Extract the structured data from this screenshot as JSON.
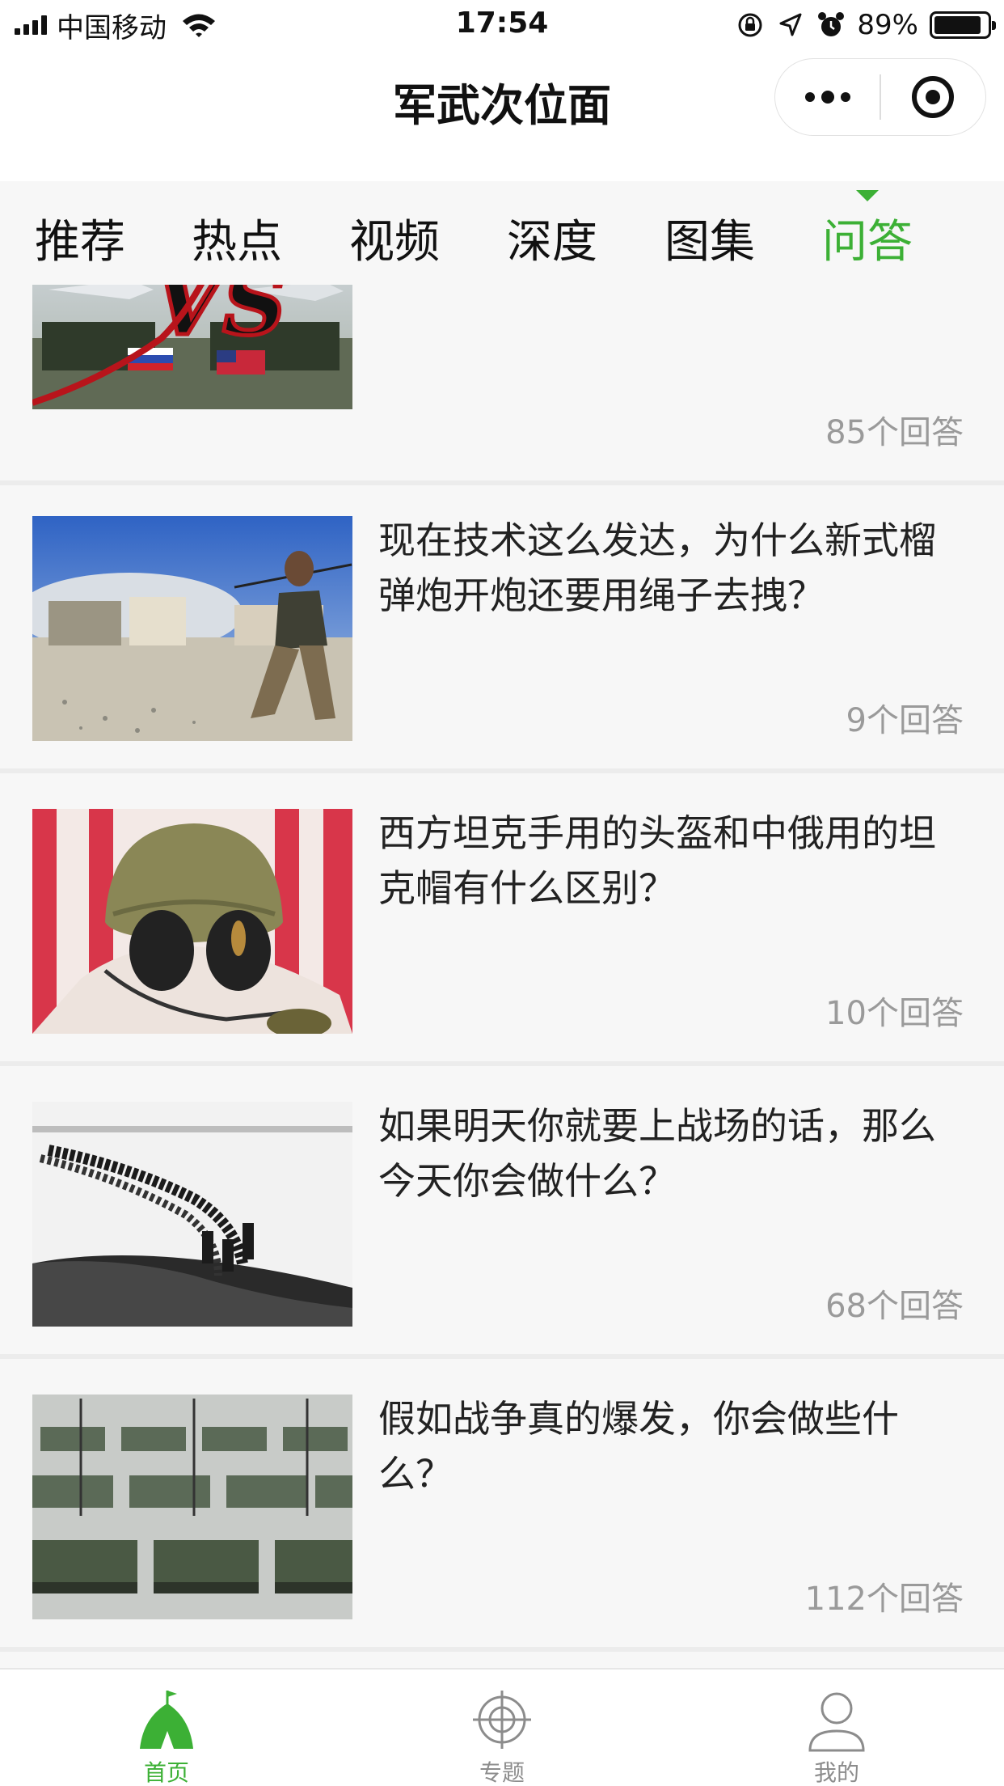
{
  "status_bar": {
    "carrier": "中国移动",
    "time": "17:54",
    "battery_percent": "89%",
    "battery_level": 0.89,
    "icons": [
      "signal-icon",
      "wifi-icon",
      "orientation-lock-icon",
      "location-icon",
      "alarm-icon",
      "battery-icon"
    ]
  },
  "nav": {
    "title": "军武次位面",
    "capsule": {
      "more_icon": "more-dots-icon",
      "close_icon": "target-circle-icon"
    }
  },
  "tabs": [
    {
      "label": "推荐"
    },
    {
      "label": "热点"
    },
    {
      "label": "视频"
    },
    {
      "label": "深度"
    },
    {
      "label": "图集"
    },
    {
      "label": "问答"
    }
  ],
  "active_tab": "问答",
  "accent_color": "#3cb035",
  "questions": [
    {
      "title": "",
      "answers": "85个回答",
      "thumb": "jets-vs-soldiers-image"
    },
    {
      "title": "现在技术这么发达，为什么新式榴弹炮开炮还要用绳子去拽？",
      "answers": "9个回答",
      "thumb": "howitzer-lanyard-image"
    },
    {
      "title": "西方坦克手用的头盔和中俄用的坦克帽有什么区别？",
      "answers": "10个回答",
      "thumb": "tank-helmet-image"
    },
    {
      "title": "如果明天你就要上战场的话，那么今天你会做什么？",
      "answers": "68个回答",
      "thumb": "soldiers-marching-image"
    },
    {
      "title": "假如战争真的爆发，你会做些什么？",
      "answers": "112个回答",
      "thumb": "tank-formation-image"
    }
  ],
  "tabbar": [
    {
      "label": "首页",
      "icon": "home-tent-icon"
    },
    {
      "label": "专题",
      "icon": "crosshair-icon"
    },
    {
      "label": "我的",
      "icon": "user-icon"
    }
  ]
}
